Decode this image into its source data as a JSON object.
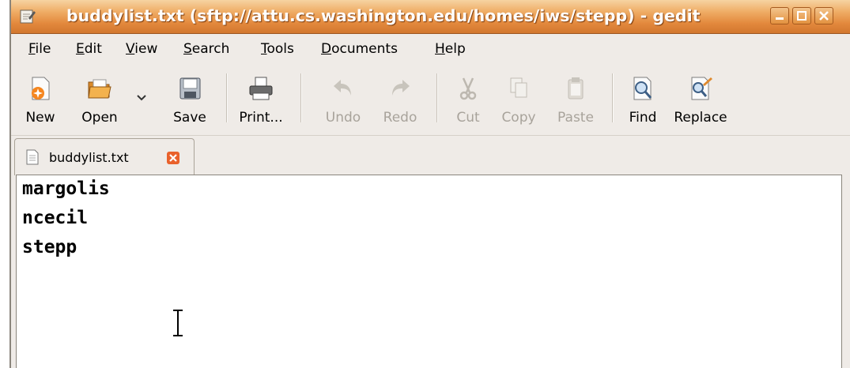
{
  "window": {
    "title": "buddylist.txt (sftp://attu.cs.washington.edu/homes/iws/stepp) - gedit",
    "controls": [
      "minimize-icon",
      "maximize-icon",
      "close-icon"
    ]
  },
  "menubar": {
    "items": [
      {
        "label": "File",
        "mnemonic": "F",
        "rest": "ile"
      },
      {
        "label": "Edit",
        "mnemonic": "E",
        "rest": "dit"
      },
      {
        "label": "View",
        "mnemonic": "V",
        "rest": "iew"
      },
      {
        "label": "Search",
        "mnemonic": "S",
        "rest": "earch"
      },
      {
        "label": "Tools",
        "mnemonic": "T",
        "rest": "ools"
      },
      {
        "label": "Documents",
        "mnemonic": "D",
        "rest": "ocuments"
      },
      {
        "label": "Help",
        "mnemonic": "H",
        "rest": "elp"
      }
    ]
  },
  "toolbar": {
    "new": "New",
    "open": "Open",
    "save": "Save",
    "print": "Print...",
    "undo": "Undo",
    "redo": "Redo",
    "cut": "Cut",
    "copy": "Copy",
    "paste": "Paste",
    "find": "Find",
    "replace": "Replace"
  },
  "tabs": [
    {
      "label": "buddylist.txt"
    }
  ],
  "editor": {
    "lines": [
      "margolis",
      "ncecil",
      "stepp"
    ]
  }
}
